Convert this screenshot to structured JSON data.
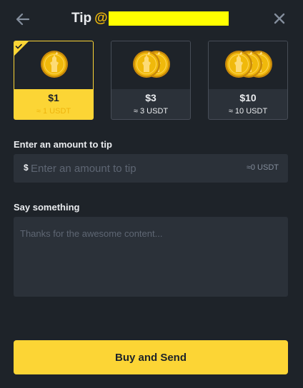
{
  "header": {
    "title": "Tip",
    "at_symbol": "@",
    "back_icon": "arrow-left-icon",
    "close_icon": "close-icon"
  },
  "tip_options": [
    {
      "amount": "$1",
      "usdt": "≈ 1 USDT",
      "coins": 1,
      "selected": true
    },
    {
      "amount": "$3",
      "usdt": "≈ 3 USDT",
      "coins": 2,
      "selected": false
    },
    {
      "amount": "$10",
      "usdt": "≈ 10 USDT",
      "coins": 3,
      "selected": false
    }
  ],
  "amount_section": {
    "label": "Enter an amount to tip",
    "currency_symbol": "$",
    "placeholder": "Enter an amount to tip",
    "value": "",
    "approx": "≈0 USDT"
  },
  "message_section": {
    "label": "Say something",
    "placeholder": "Thanks for the awesome content...",
    "value": ""
  },
  "submit_label": "Buy and Send",
  "colors": {
    "background": "#1e2329",
    "panel": "#2b3139",
    "accent": "#fcd535",
    "coin": "#f0b90b",
    "redaction": "#ffff00"
  }
}
